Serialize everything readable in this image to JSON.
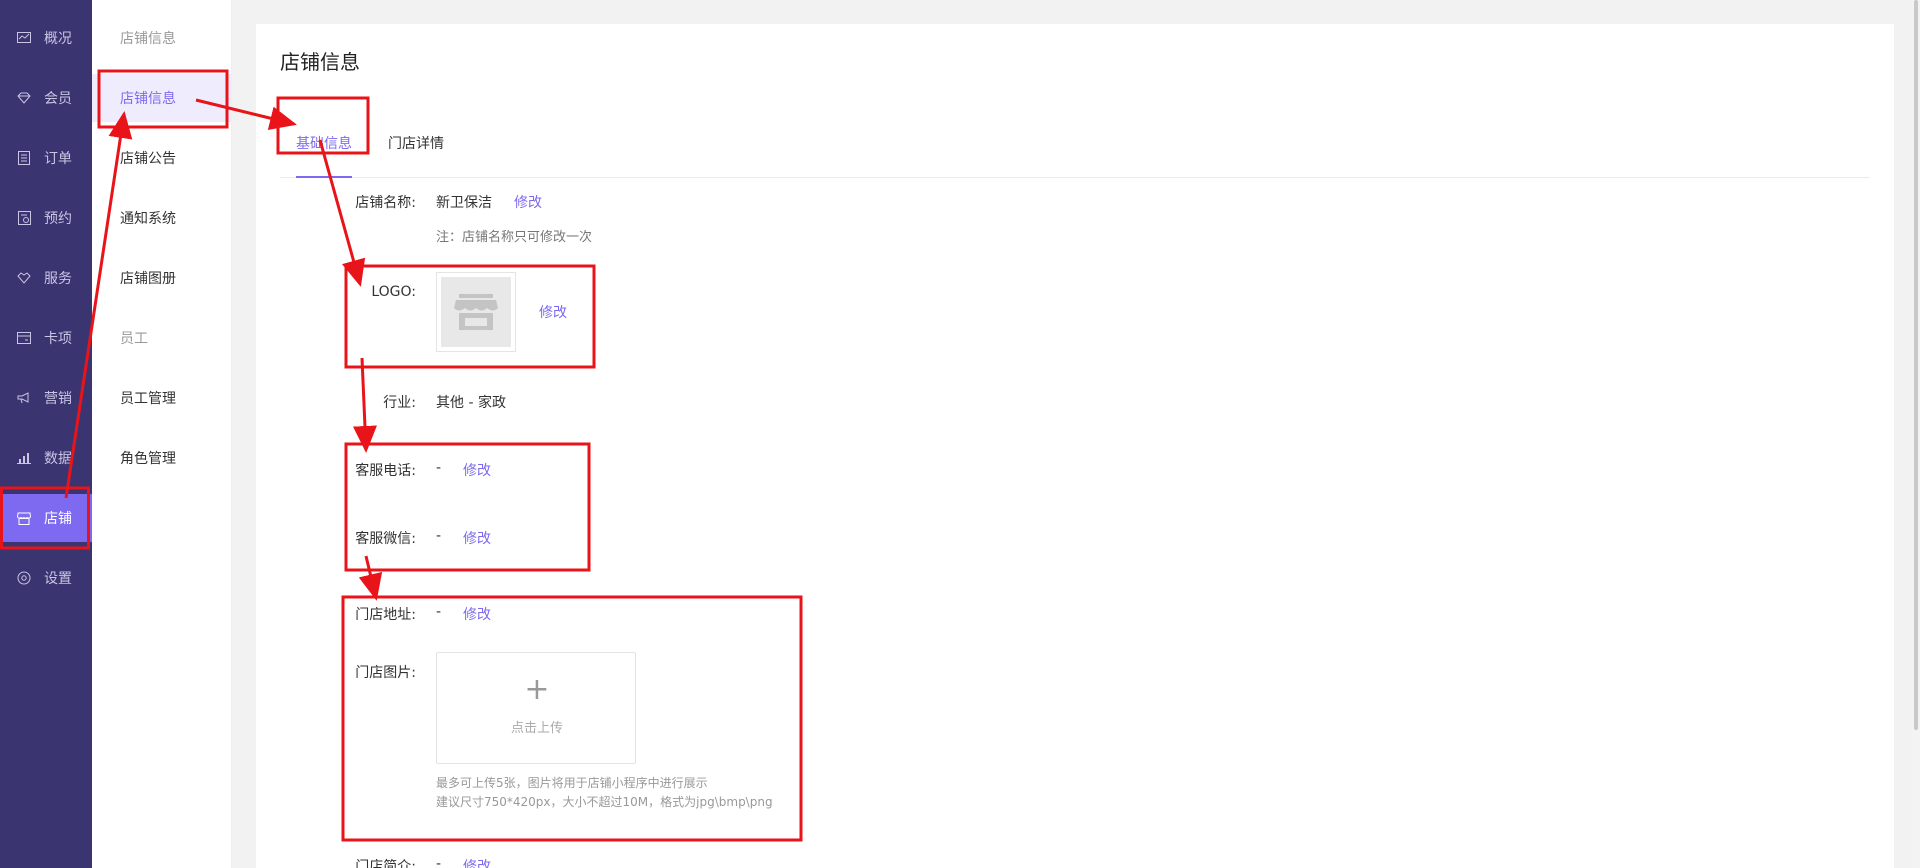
{
  "nav": {
    "items": [
      {
        "label": "概况",
        "icon": "overview-icon"
      },
      {
        "label": "会员",
        "icon": "member-icon"
      },
      {
        "label": "订单",
        "icon": "order-icon"
      },
      {
        "label": "预约",
        "icon": "appointment-icon"
      },
      {
        "label": "服务",
        "icon": "service-icon"
      },
      {
        "label": "卡项",
        "icon": "card-icon"
      },
      {
        "label": "营销",
        "icon": "marketing-icon"
      },
      {
        "label": "数据",
        "icon": "data-icon"
      },
      {
        "label": "店铺",
        "icon": "store-icon"
      },
      {
        "label": "设置",
        "icon": "settings-icon"
      }
    ],
    "active_index": 8
  },
  "subnav": {
    "group_store": "店铺信息",
    "items_store": [
      "店铺信息",
      "店铺公告",
      "通知系统",
      "店铺图册"
    ],
    "group_staff": "员工",
    "items_staff": [
      "员工管理",
      "角色管理"
    ]
  },
  "main": {
    "title": "店铺信息",
    "tabs": [
      {
        "label": "基础信息",
        "active": true
      },
      {
        "label": "门店详情",
        "active": false
      }
    ],
    "fields": {
      "name_label": "店铺名称:",
      "name_value": "新卫保洁",
      "name_edit": "修改",
      "name_note": "注：店铺名称只可修改一次",
      "logo_label": "LOGO:",
      "logo_edit": "修改",
      "industry_label": "行业:",
      "industry_value": "其他 - 家政",
      "phone_label": "客服电话:",
      "phone_value": "-",
      "phone_edit": "修改",
      "wechat_label": "客服微信:",
      "wechat_value": "-",
      "wechat_edit": "修改",
      "address_label": "门店地址:",
      "address_value": "-",
      "address_edit": "修改",
      "images_label": "门店图片:",
      "upload_plus": "+",
      "upload_text": "点击上传",
      "upload_hint_1": "最多可上传5张，图片将用于店铺小程序中进行展示",
      "upload_hint_2": "建议尺寸750*420px，大小不超过10M，格式为jpg\\bmp\\png",
      "intro_label": "门店简介:",
      "intro_value": "-",
      "intro_edit": "修改"
    }
  },
  "colors": {
    "accent": "#7d6af1",
    "nav_bg": "#3a3470",
    "annotation": "#e8141a"
  }
}
